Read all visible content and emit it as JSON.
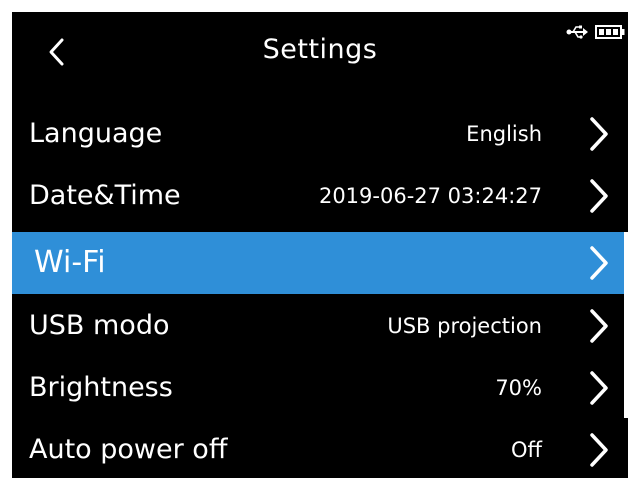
{
  "header": {
    "title": "Settings",
    "back_icon": "chevron-left-icon",
    "status_icons": [
      "usb-icon",
      "battery-icon"
    ]
  },
  "settings": [
    {
      "label": "Language",
      "value": "English",
      "selected": false
    },
    {
      "label": "Date&Time",
      "value": "2019-06-27 03:24:27",
      "selected": false
    },
    {
      "label": "Wi-Fi",
      "value": "",
      "selected": true
    },
    {
      "label": "USB modo",
      "value": "USB projection",
      "selected": false
    },
    {
      "label": "Brightness",
      "value": "70%",
      "selected": false
    },
    {
      "label": "Auto power off",
      "value": "Off",
      "selected": false
    }
  ],
  "colors": {
    "background": "#000000",
    "selected_row": "#2f8fd8",
    "text": "#ffffff"
  }
}
